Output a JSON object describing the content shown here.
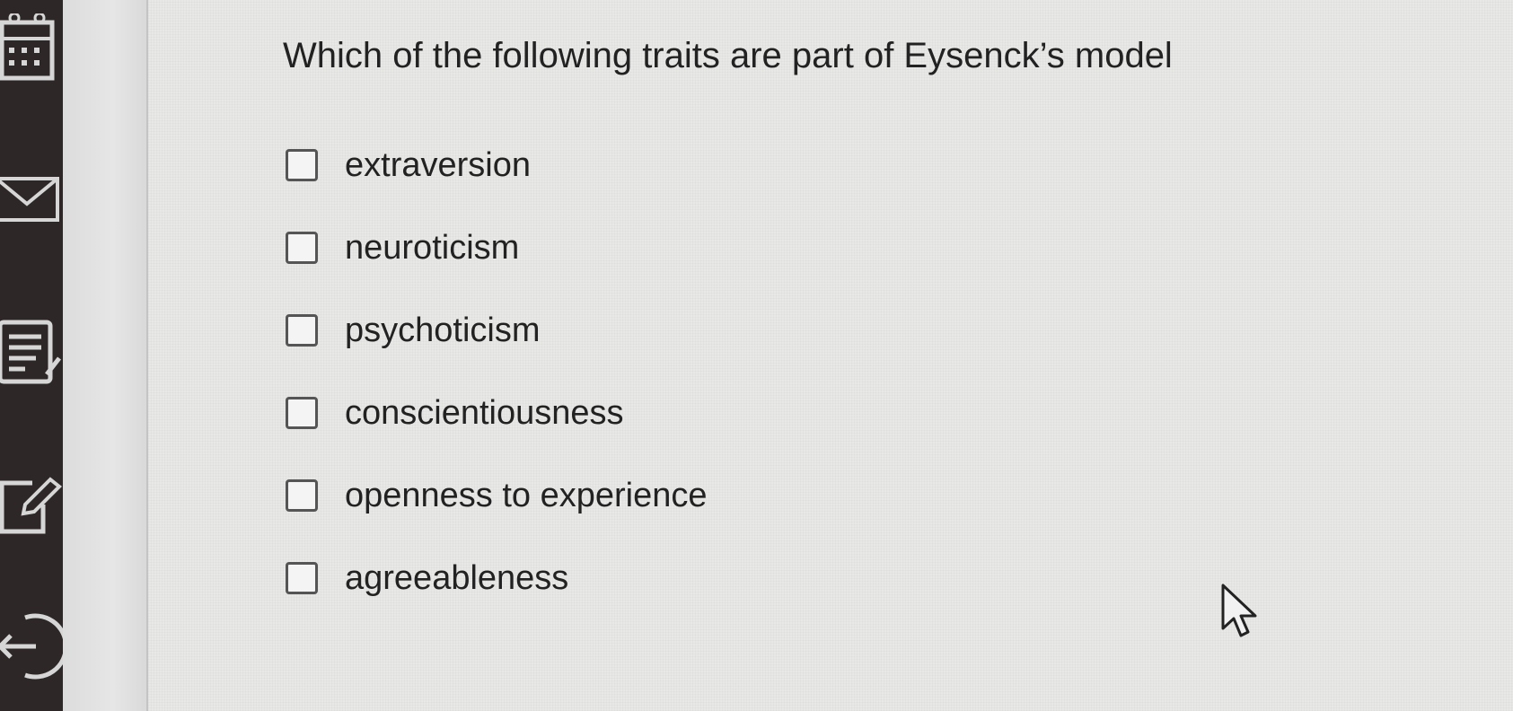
{
  "quiz": {
    "question": "Which of the following traits are part of Eysenck’s model",
    "options": [
      {
        "label": "extraversion",
        "checked": false
      },
      {
        "label": "neuroticism",
        "checked": false
      },
      {
        "label": "psychoticism",
        "checked": false
      },
      {
        "label": "conscientiousness",
        "checked": false
      },
      {
        "label": "openness to experience",
        "checked": false
      },
      {
        "label": "agreeableness",
        "checked": false
      }
    ]
  },
  "sidebar": {
    "icons": [
      "calendar-icon",
      "mail-icon",
      "notes-icon",
      "edit-icon",
      "logout-icon"
    ]
  },
  "colors": {
    "sidebar": "#2d2827",
    "content_background": "#e8e8e6",
    "text": "#222222"
  }
}
